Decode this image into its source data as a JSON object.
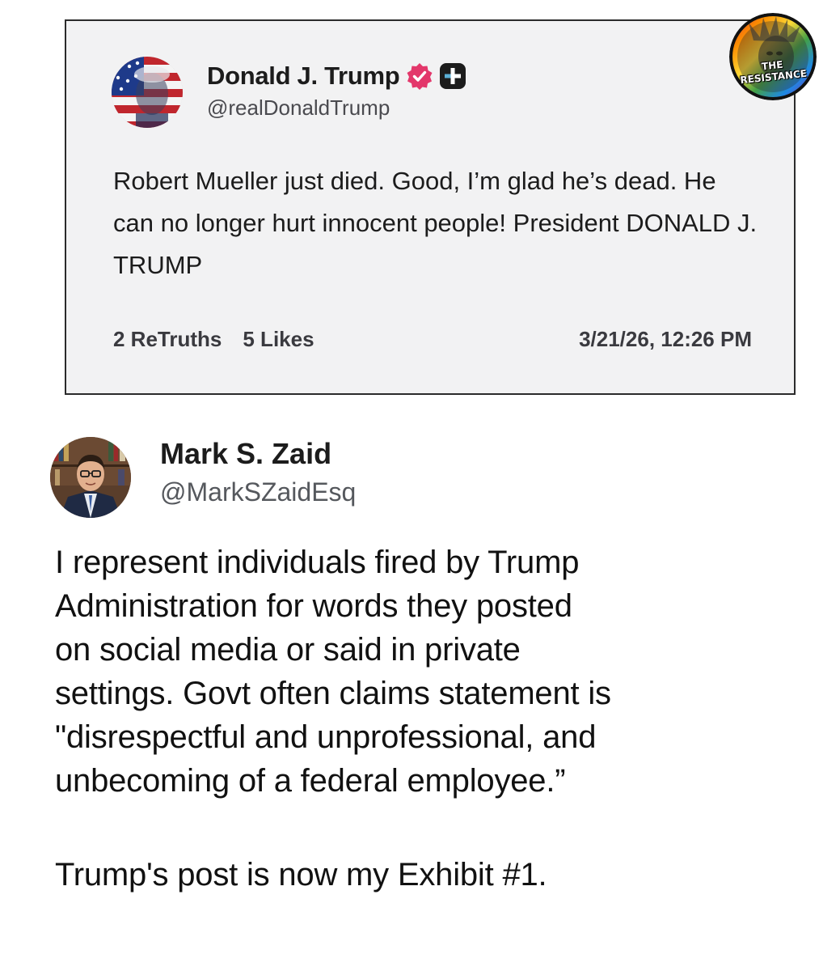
{
  "truth_post": {
    "author_name": "Donald J. Trump",
    "handle": "@realDonaldTrump",
    "text": "Robert Mueller just died. Good, I’m glad he’s dead. He can no longer hurt innocent people! President DONALD J. TRUMP",
    "retruths": "2 ReTruths",
    "likes": "5 Likes",
    "timestamp": "3/21/26, 12:26 PM",
    "icons": [
      "avatar-flag-portrait",
      "verified-badge-icon",
      "plus-badge-icon"
    ],
    "colors": {
      "card_background": "#f2f2f3",
      "verified_badge": "#e3376b",
      "plus_badge": "#1c1c1c"
    }
  },
  "badge": {
    "line1": "THE",
    "line2": "RESISTANCE"
  },
  "tweet": {
    "author_name": "Mark S. Zaid",
    "handle": "@MarkSZaidEsq",
    "lines": [
      "I represent individuals fired by Trump",
      "Administration for words they posted",
      "on social media or said in private",
      "settings. Govt often claims statement is",
      "\"disrespectful and unprofessional, and",
      "unbecoming of a federal employee.”"
    ],
    "closing": "Trump's post is now my Exhibit #1."
  }
}
